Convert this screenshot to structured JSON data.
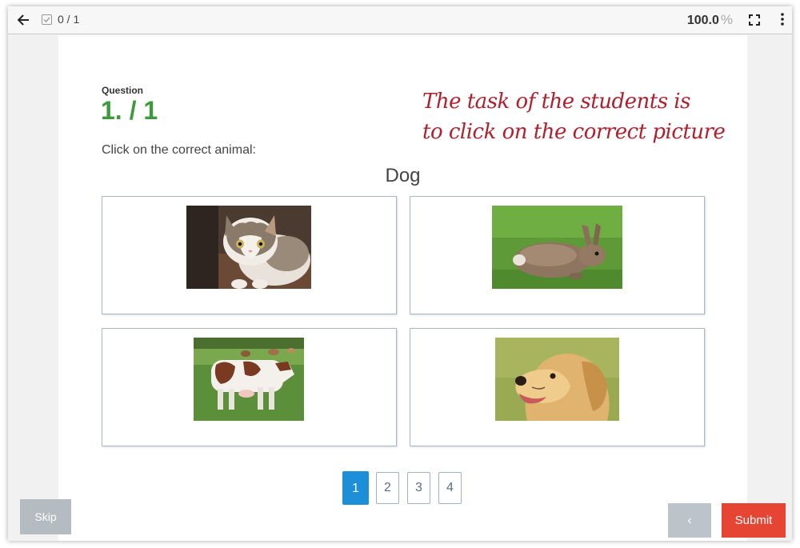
{
  "toolbar": {
    "progress": "0 / 1",
    "zoom": "100.0",
    "zoom_unit": "%",
    "icons": [
      "back-arrow-icon",
      "checkbox-icon",
      "fullscreen-icon",
      "more-vert-icon"
    ]
  },
  "question": {
    "label": "Question",
    "number": "1. / 1",
    "instruction": "Click on the correct animal:",
    "target": "Dog"
  },
  "annotation": {
    "line1": "The task of the students is",
    "line2": "to click on the correct picture",
    "color": "#b0202e"
  },
  "options": [
    {
      "animal": "cat"
    },
    {
      "animal": "rabbit"
    },
    {
      "animal": "cow"
    },
    {
      "animal": "dog"
    }
  ],
  "pagination": {
    "pages": [
      "1",
      "2",
      "3",
      "4"
    ],
    "current": 1
  },
  "buttons": {
    "skip": "Skip",
    "prev": "‹",
    "submit": "Submit"
  },
  "colors": {
    "accent_blue": "#1d8fd8",
    "question_green": "#3d9a3d",
    "submit_red": "#e64534"
  }
}
